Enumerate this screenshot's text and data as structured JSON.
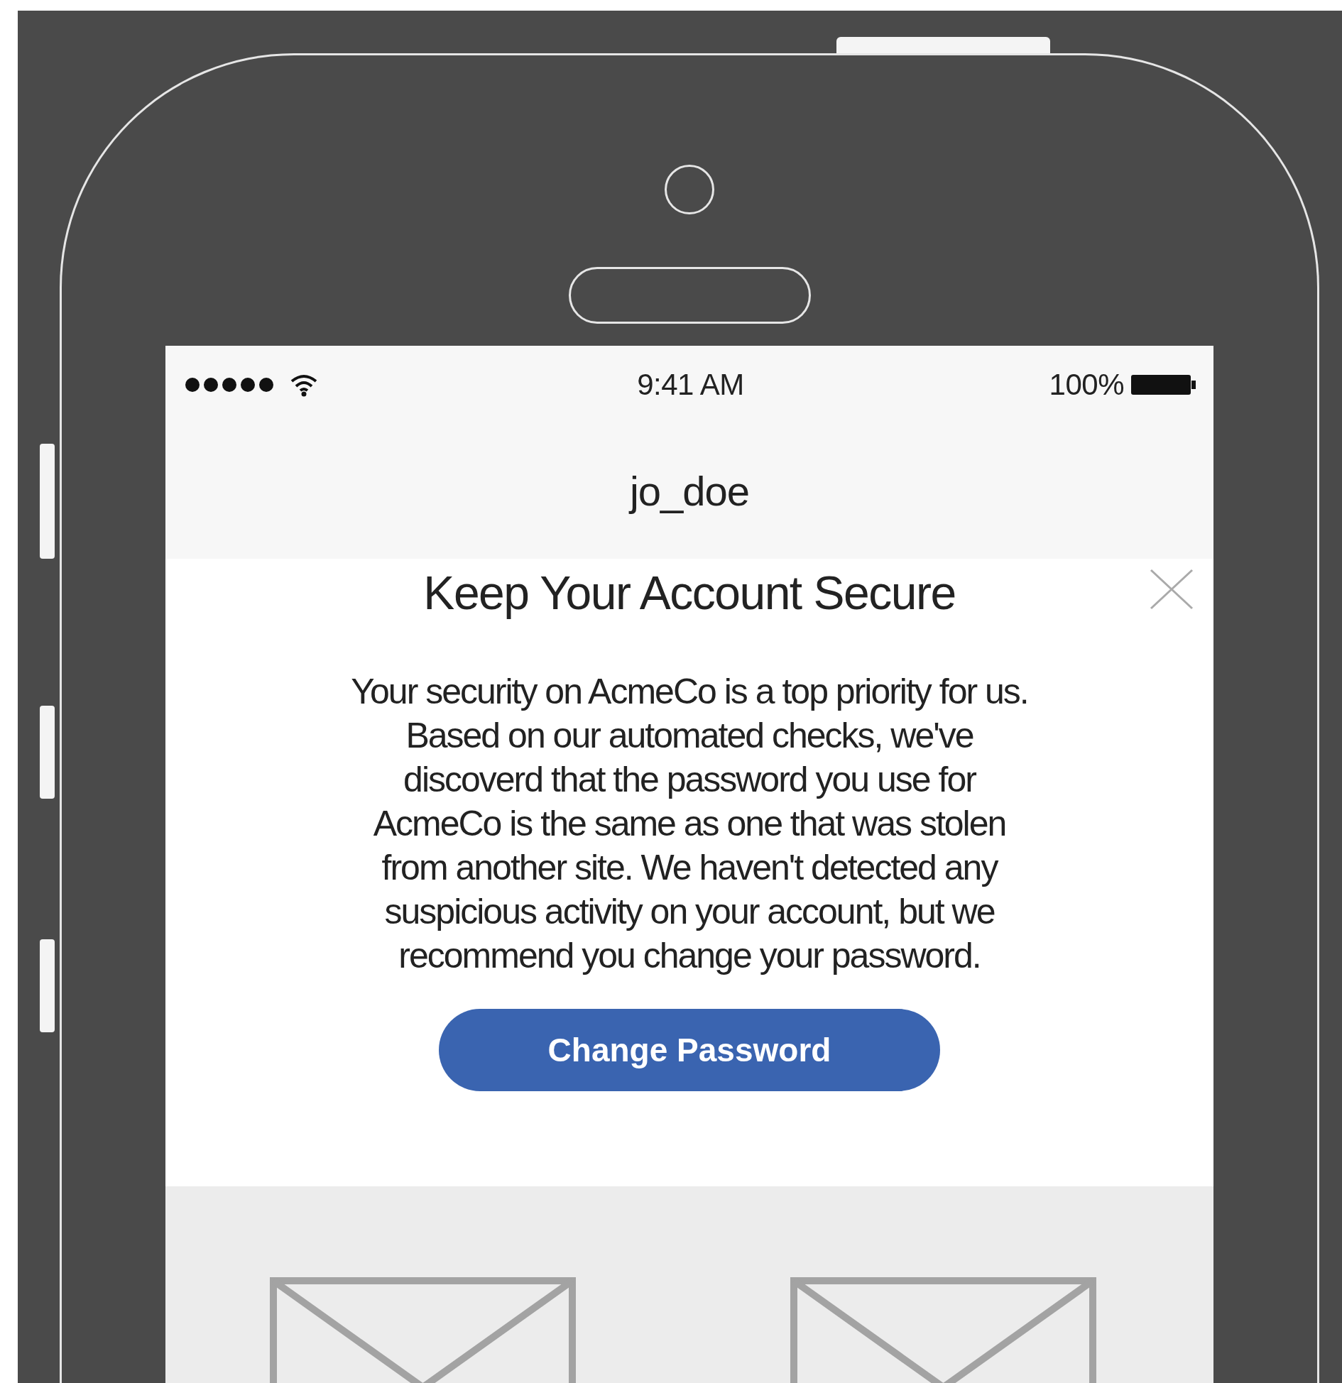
{
  "status_bar": {
    "time": "9:41 AM",
    "battery": "100%"
  },
  "nav_bar": {
    "title": "jo_doe"
  },
  "alert": {
    "title": "Keep Your Account Secure",
    "message": "Your security on AcmeCo is a top priority for us. Based on our automated checks, we've discoverd that the password you use for AcmeCo is the same as one that was stolen from another site. We haven't detected any suspicious activity on your account, but we recommend you change your password.",
    "button": "Change Password"
  }
}
